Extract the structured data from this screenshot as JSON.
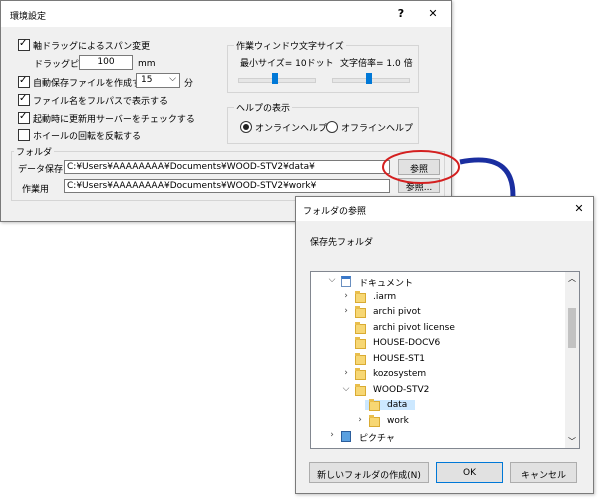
{
  "env_dialog": {
    "title": "環境設定",
    "help_glyph": "?",
    "close_glyph": "✕",
    "drag_span_label": "軸ドラッグによるスパン変更",
    "drag_pitch_label": "ドラッグピッチ",
    "drag_pitch_value": "100",
    "drag_pitch_unit": "mm",
    "autosave_label": "自動保存ファイルを作成する",
    "autosave_value": "15",
    "autosave_unit": "分",
    "fullpath_label": "ファイル名をフルパスで表示する",
    "update_check_label": "起動時に更新用サーバーをチェックする",
    "wheel_reverse_label": "ホイールの回転を反転する",
    "checks": {
      "drag_span": true,
      "autosave": true,
      "fullpath": true,
      "update_check": true,
      "wheel_reverse": false
    },
    "font_group_title": "作業ウィンドウ文字サイズ",
    "min_size_label": "最小サイズ= 10ドット",
    "scale_label": "文字倍率= 1.0 倍",
    "help_group_title": "ヘルプの表示",
    "online_help_label": "オンラインヘルプ",
    "offline_help_label": "オフラインヘルプ",
    "selected_help": "online",
    "folder_group_title": "フォルダ",
    "data_save_label": "データ保存",
    "data_save_path": "C:¥Users¥AAAAAAAA¥Documents¥WOOD-STV2¥data¥",
    "work_label": "作業用",
    "work_path": "C:¥Users¥AAAAAAAA¥Documents¥WOOD-STV2¥work¥",
    "browse_label": "参照",
    "browse_label_2": "参照..."
  },
  "folder_dialog": {
    "title": "フォルダの参照",
    "close_glyph": "✕",
    "prompt": "保存先フォルダ",
    "tree": [
      {
        "label": "ドキュメント",
        "level": 0,
        "expander": "expanded",
        "icon": "documents-icon"
      },
      {
        "label": ".iarm",
        "level": 1,
        "expander": "collapsed",
        "icon": "folder-icon"
      },
      {
        "label": "archi pivot",
        "level": 1,
        "expander": "collapsed",
        "icon": "folder-icon"
      },
      {
        "label": "archi pivot license",
        "level": 1,
        "expander": "none",
        "icon": "folder-icon"
      },
      {
        "label": "HOUSE-DOCV6",
        "level": 1,
        "expander": "none",
        "icon": "folder-icon"
      },
      {
        "label": "HOUSE-ST1",
        "level": 1,
        "expander": "none",
        "icon": "folder-icon"
      },
      {
        "label": "kozosystem",
        "level": 1,
        "expander": "collapsed",
        "icon": "folder-icon"
      },
      {
        "label": "WOOD-STV2",
        "level": 1,
        "expander": "expanded",
        "icon": "folder-icon"
      },
      {
        "label": "data",
        "level": 2,
        "expander": "none",
        "icon": "folder-icon",
        "selected": true
      },
      {
        "label": "work",
        "level": 2,
        "expander": "collapsed",
        "icon": "folder-icon"
      },
      {
        "label": "ピクチャ",
        "level": 0,
        "expander": "collapsed",
        "icon": "pictures-icon"
      }
    ],
    "new_folder_label": "新しいフォルダの作成(N)",
    "ok_label": "OK",
    "cancel_label": "キャンセル"
  },
  "colors": {
    "highlight_circle": "#d42020",
    "arrow": "#1a2ea0",
    "selection": "#cce8ff",
    "accent": "#0078d7"
  }
}
